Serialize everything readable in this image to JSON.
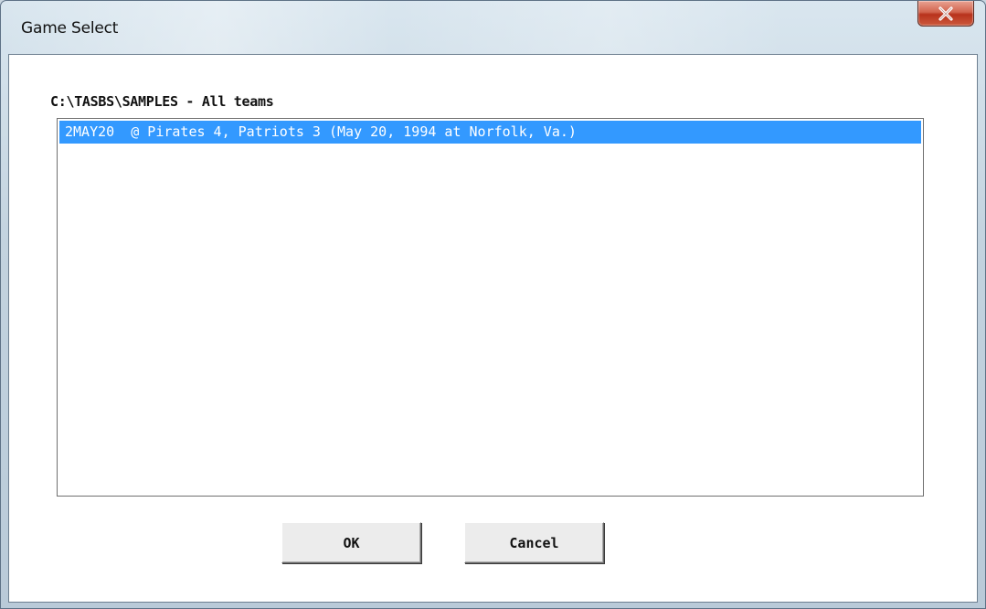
{
  "window": {
    "title": "Game Select"
  },
  "dialog": {
    "path_label": "C:\\TASBS\\SAMPLES - All teams",
    "games": [
      {
        "text": "2MAY20  @ Pirates 4, Patriots 3 (May 20, 1994 at Norfolk, Va.)",
        "selected": true
      }
    ]
  },
  "buttons": {
    "ok_label": "OK",
    "cancel_label": "Cancel"
  },
  "icons": {
    "close": "close-icon"
  },
  "colors": {
    "selection": "#3399ff",
    "close_button": "#c9452a"
  }
}
